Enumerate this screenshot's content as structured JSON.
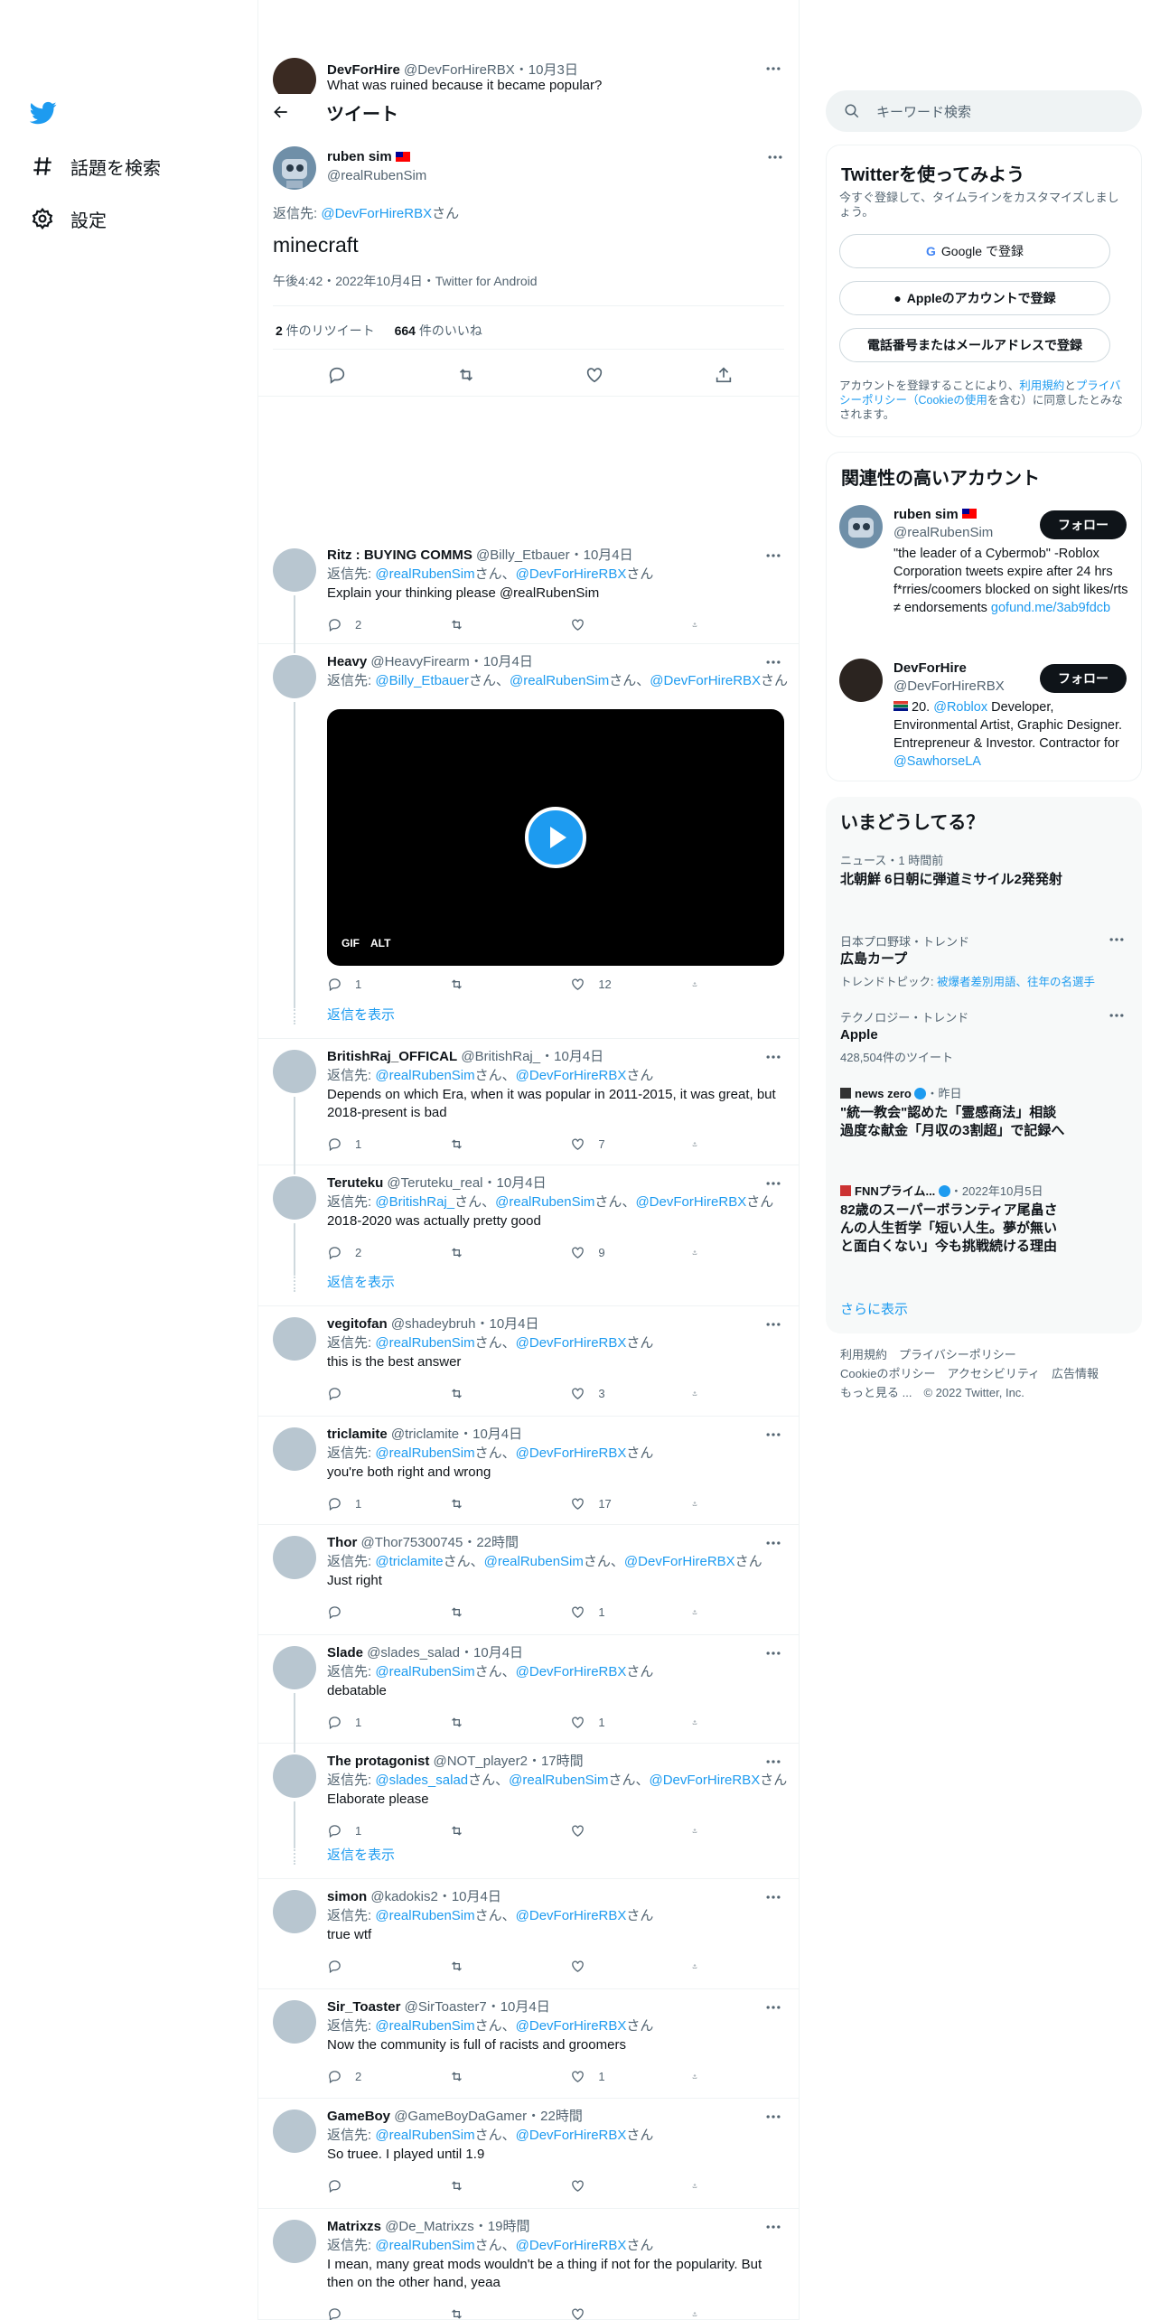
{
  "nav": {
    "explore": "話題を検索",
    "settings": "設定"
  },
  "ghost": {
    "name": "DevForHire",
    "handle": "@DevForHireRBX",
    "date": "10月3日",
    "text": "What was ruined because it became popular?"
  },
  "header": {
    "title": "ツイート"
  },
  "main": {
    "name": "ruben sim",
    "handle": "@realRubenSim",
    "reply_prefix": "返信先: ",
    "reply_to": "@DevForHireRBX",
    "reply_suffix": "さん",
    "text": "minecraft",
    "timestamp": "午後4:42・2022年10月4日・Twitter for Android",
    "retweets_num": "2",
    "retweets_label": " 件のリツイート",
    "likes_num": "664",
    "likes_label": " 件のいいね"
  },
  "replies": [
    {
      "name": "Ritz : BUYING COMMS",
      "handle": "@Billy_Etbauer",
      "date": "10月4日",
      "to": [
        "@realRubenSim",
        "@DevForHireRBX"
      ],
      "text": "Explain your thinking please @realRubenSim",
      "reply": "2",
      "rt": "",
      "like": ""
    },
    {
      "name": "Heavy",
      "handle": "@HeavyFirearm",
      "date": "10月4日",
      "to": [
        "@Billy_Etbauer",
        "@realRubenSim",
        "@DevForHireRBX"
      ],
      "text": "",
      "reply": "1",
      "rt": "",
      "like": "12"
    },
    {
      "name": "BritishRaj_OFFICAL",
      "handle": "@BritishRaj_",
      "date": "10月4日",
      "to": [
        "@realRubenSim",
        "@DevForHireRBX"
      ],
      "text": "Depends on which Era, when it was popular in 2011-2015, it was great, but 2018-present is bad",
      "reply": "1",
      "rt": "",
      "like": "7"
    },
    {
      "name": "Teruteku",
      "handle": "@Teruteku_real",
      "date": "10月4日",
      "to": [
        "@BritishRaj_",
        "@realRubenSim",
        "@DevForHireRBX"
      ],
      "text": "2018-2020 was actually pretty good",
      "reply": "2",
      "rt": "",
      "like": "9"
    },
    {
      "name": "vegitofan",
      "handle": "@shadeybruh",
      "date": "10月4日",
      "to": [
        "@realRubenSim",
        "@DevForHireRBX"
      ],
      "text": "this is the best answer",
      "reply": "",
      "rt": "",
      "like": "3"
    },
    {
      "name": "triclamite",
      "handle": "@triclamite",
      "date": "10月4日",
      "to": [
        "@realRubenSim",
        "@DevForHireRBX"
      ],
      "text": "you're both right and wrong",
      "reply": "1",
      "rt": "",
      "like": "17"
    },
    {
      "name": "Thor",
      "handle": "@Thor75300745",
      "date": "22時間",
      "to": [
        "@triclamite",
        "@realRubenSim",
        "@DevForHireRBX"
      ],
      "text": "Just right",
      "reply": "",
      "rt": "",
      "like": "1"
    },
    {
      "name": "Slade",
      "handle": "@slades_salad",
      "date": "10月4日",
      "to": [
        "@realRubenSim",
        "@DevForHireRBX"
      ],
      "text": "debatable",
      "reply": "1",
      "rt": "",
      "like": "1"
    },
    {
      "name": "The protagonist",
      "handle": "@NOT_player2",
      "date": "17時間",
      "to": [
        "@slades_salad",
        "@realRubenSim",
        "@DevForHireRBX"
      ],
      "text": "Elaborate please",
      "reply": "1",
      "rt": "",
      "like": ""
    },
    {
      "name": "simon",
      "handle": "@kadokis2",
      "date": "10月4日",
      "to": [
        "@realRubenSim",
        "@DevForHireRBX"
      ],
      "text": "true wtf",
      "reply": "",
      "rt": "",
      "like": ""
    },
    {
      "name": "Sir_Toaster",
      "handle": "@SirToaster7",
      "date": "10月4日",
      "to": [
        "@realRubenSim",
        "@DevForHireRBX"
      ],
      "text": "Now the community is full of racists and groomers",
      "reply": "2",
      "rt": "",
      "like": "1"
    },
    {
      "name": "GameBoy",
      "handle": "@GameBoyDaGamer",
      "date": "22時間",
      "to": [
        "@realRubenSim",
        "@DevForHireRBX"
      ],
      "text": "So truee. I played until 1.9",
      "reply": "",
      "rt": "",
      "like": ""
    },
    {
      "name": "Matrixzs",
      "handle": "@De_Matrixzs",
      "date": "19時間",
      "to": [
        "@realRubenSim",
        "@DevForHireRBX"
      ],
      "text": "I mean, many great mods wouldn't be a thing if not for the popularity. But then on the other hand, yeaa",
      "reply": "",
      "rt": "",
      "like": ""
    }
  ],
  "reply_common": {
    "prefix": "返信先: ",
    "san": "さん",
    "sep": "、",
    "dot": "・"
  },
  "show_replies": "返信を表示",
  "media": {
    "gif": "GIF",
    "alt": "ALT"
  },
  "search": {
    "placeholder": "キーワード検索"
  },
  "signup": {
    "title": "Twitterを使ってみよう",
    "sub": "今すぐ登録して、タイムラインをカスタマイズしましょう。",
    "google": "Google で登録",
    "apple": "Appleのアカウントで登録",
    "phone": "電話番号またはメールアドレスで登録",
    "terms_a": "アカウントを登録することにより、",
    "terms_link1": "利用規約",
    "terms_and": "と",
    "terms_link2": "プライバシーポリシー（Cookieの使用",
    "terms_b": "を含む）に同意したとみなされます。"
  },
  "relevant": {
    "title": "関連性の高いアカウント",
    "follow": "フォロー",
    "accounts": [
      {
        "name": "ruben sim",
        "handle": "@realRubenSim",
        "bio": "\"the leader of a Cybermob\" -Roblox Corporation tweets expire after 24 hrs f*rries/coomers blocked on sight likes/rts ≠ endorsements",
        "link": "gofund.me/3ab9fdcb"
      },
      {
        "name": "DevForHire",
        "handle": "@DevForHireRBX",
        "bio_a": " 20. ",
        "bio_link": "@Roblox",
        "bio_b": " Developer, Environmental Artist, Graphic Designer. Entrepreneur & Investor. Contractor for ",
        "bio_link2": "@SawhorseLA"
      }
    ]
  },
  "trends": {
    "title": "いまどうしてる？",
    "items": [
      {
        "meta": "ニュース・1 時間前",
        "title": "北朝鮮 6日朝に弾道ミサイル2発発射"
      },
      {
        "meta": "日本プロ野球・トレンド",
        "title": "広島カープ",
        "sub": "トレンドトピック: ",
        "sub_links": "被爆者差別用語、往年の名選手"
      },
      {
        "meta": "テクノロジー・トレンド",
        "title": "Apple",
        "sub": "428,504件のツイート"
      },
      {
        "meta": "news zero",
        "meta2": "・昨日",
        "title": "\"統一教会\"認めた「霊感商法」相談　過度な献金「月収の3割超」で記録へ"
      },
      {
        "meta": "FNNプライム...",
        "meta2": "・2022年10月5日",
        "title": "82歳のスーパーボランティア尾畠さんの人生哲学「短い人生。夢が無いと面白くない」今も挑戦続ける理由"
      }
    ],
    "more": "さらに表示"
  },
  "footer": {
    "line1": "利用規約　プライバシーポリシー",
    "line2": "Cookieのポリシー　アクセシビリティ　広告情報",
    "line3": "もっと見る ...　© 2022 Twitter, Inc."
  },
  "colors": {
    "accent": "#1d9bf0",
    "text": "#0f1419",
    "muted": "#536471"
  }
}
